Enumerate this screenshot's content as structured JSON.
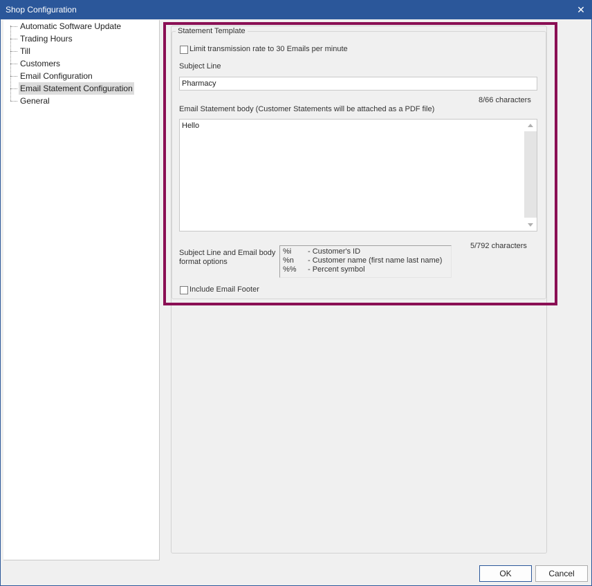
{
  "window": {
    "title": "Shop Configuration"
  },
  "tree": {
    "items": [
      {
        "label": "Automatic Software Update",
        "selected": false
      },
      {
        "label": "Trading Hours",
        "selected": false
      },
      {
        "label": "Till",
        "selected": false
      },
      {
        "label": "Customers",
        "selected": false
      },
      {
        "label": "Email Configuration",
        "selected": false
      },
      {
        "label": "Email Statement Configuration",
        "selected": true
      },
      {
        "label": "General",
        "selected": false
      }
    ]
  },
  "statement": {
    "group_title": "Statement Template",
    "limit_checkbox_label": "Limit transmission rate to 30 Emails per minute",
    "limit_checked": false,
    "subject_label": "Subject Line",
    "subject_value": "Pharmacy",
    "subject_count": "8/66 characters",
    "body_label": "Email Statement body (Customer Statements will be attached as a PDF file)",
    "body_value": "Hello",
    "body_count": "5/792 characters",
    "format_label_line1": "Subject Line and Email body",
    "format_label_line2": "format options",
    "format_options": [
      {
        "code": "%i",
        "desc": "- Customer's ID"
      },
      {
        "code": "%n",
        "desc": "- Customer name (first name last name)"
      },
      {
        "code": "%%",
        "desc": "- Percent symbol"
      }
    ],
    "footer_checkbox_label": "Include Email Footer",
    "footer_checked": false
  },
  "buttons": {
    "ok": "OK",
    "cancel": "Cancel"
  },
  "colors": {
    "titlebar": "#2b579a",
    "highlight": "#8a0f54"
  }
}
